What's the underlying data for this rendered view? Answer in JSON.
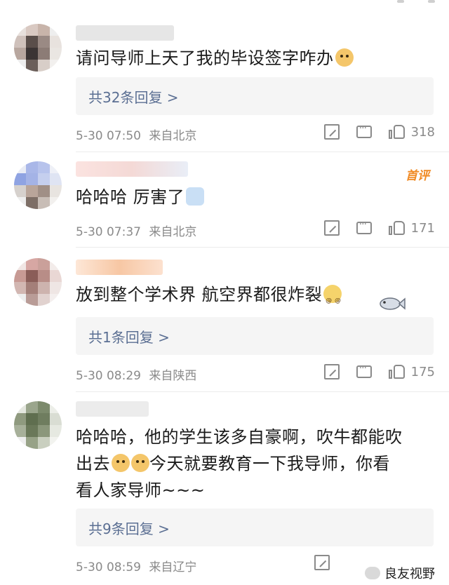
{
  "comments": [
    {
      "text": "请问导师上天了我的毕设签字咋办",
      "emoji": "doge-face-icon",
      "replies_label": "共32条回复 >",
      "time": "5-30 07:50",
      "location": "来自北京",
      "likes": "318"
    },
    {
      "text": "哈哈哈 厉害了",
      "emoji": "rocket-icon",
      "badge": "首评",
      "time": "5-30 07:37",
      "location": "来自北京",
      "likes": "171"
    },
    {
      "text": "放到整个学术界 航空界都很炸裂",
      "emoji": "dizzy-face-icon",
      "replies_label": "共1条回复 >",
      "time": "5-30 08:29",
      "location": "来自陕西",
      "likes": "175"
    },
    {
      "text_line1": "哈哈哈，他的学生该多自豪啊，吹牛都能吹",
      "text_line2_prefix": "出去",
      "text_line2_suffix": "今天就要教育一下我导师，你看",
      "text_line3": "看人家导师~~~",
      "emoji": "doge-face-icon",
      "replies_label": "共9条回复 >",
      "time": "5-30 08:59",
      "location": "来自辽宁"
    }
  ],
  "watermark": "良友视野",
  "colors": {
    "reply_link": "#5b6f93",
    "meta": "#8a8a8a",
    "badge": "#f08a24"
  }
}
